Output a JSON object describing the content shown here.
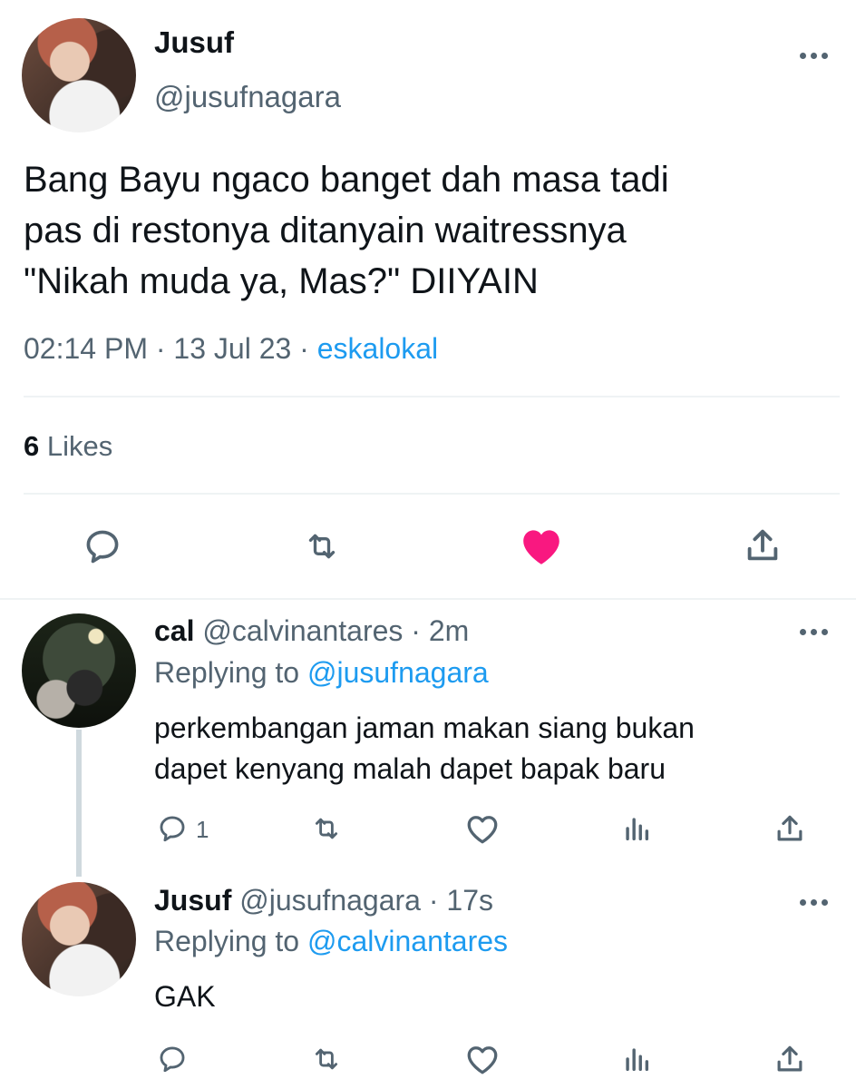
{
  "main_tweet": {
    "display_name": "Jusuf",
    "handle": "@jusufnagara",
    "text_lines": [
      "Bang Bayu ngaco banget dah masa tadi",
      "pas di restonya ditanyain waitressnya",
      "\"Nikah muda ya, Mas?\" DIIYAIN"
    ],
    "time": "02:14 PM",
    "date": "13 Jul 23",
    "source": "eskalokal",
    "sep": "·",
    "likes_count": "6",
    "likes_label": "Likes",
    "icons": [
      "reply-icon",
      "retweet-icon",
      "like-icon-filled",
      "share-icon"
    ],
    "like_color": "#f91880"
  },
  "replies": [
    {
      "display_name": "cal",
      "handle": "@calvinantares",
      "age": "2m",
      "replying_label": "Replying to",
      "replying_handle": "@jusufnagara",
      "text_lines": [
        "perkembangan jaman makan siang bukan",
        "dapet kenyang malah dapet bapak baru"
      ],
      "reply_count": "1"
    },
    {
      "display_name": "Jusuf",
      "handle": "@jusufnagara",
      "age": "17s",
      "replying_label": "Replying to",
      "replying_handle": "@calvinantares",
      "text_lines": [
        "GAK"
      ]
    }
  ],
  "colors": {
    "text": "#0f1419",
    "muted": "#536471",
    "link": "#1d9bf0",
    "divider": "#eff3f4"
  }
}
